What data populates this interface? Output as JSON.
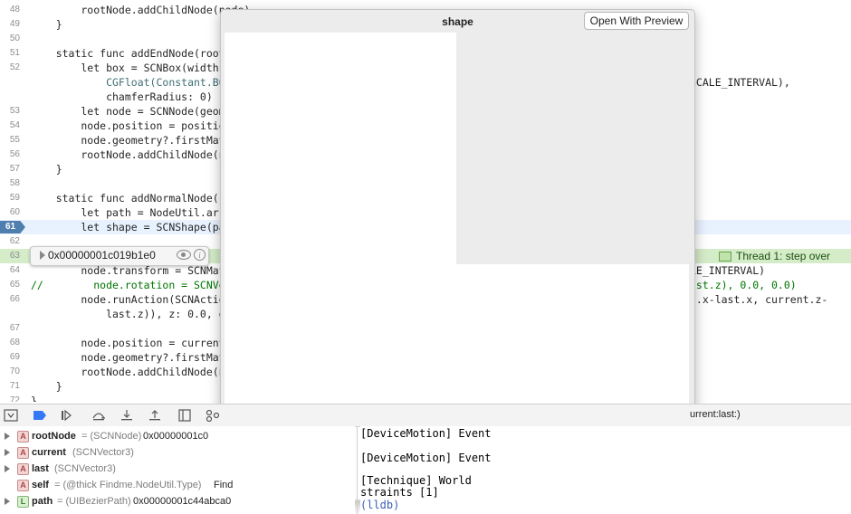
{
  "editor": {
    "lines": [
      {
        "num": "48",
        "text": "        rootNode.addChildNode(node)"
      },
      {
        "num": "49",
        "text": "    }"
      },
      {
        "num": "50",
        "text": ""
      },
      {
        "num": "51",
        "text": "    static func addEndNode(root"
      },
      {
        "num": "52",
        "text": "        let box = SCNBox(width:"
      },
      {
        "num": "",
        "text": "            CGFloat(Constant.BO"
      },
      {
        "num": "",
        "text": "            chamferRadius: 0)"
      },
      {
        "num": "53",
        "text": "        let node = SCNNode(geom"
      },
      {
        "num": "54",
        "text": "        node.position = positio"
      },
      {
        "num": "55",
        "text": "        node.geometry?.firstMat"
      },
      {
        "num": "56",
        "text": "        rootNode.addChildNode(n"
      },
      {
        "num": "57",
        "text": "    }"
      },
      {
        "num": "58",
        "text": ""
      },
      {
        "num": "59",
        "text": "    static func addNormalNode(r"
      },
      {
        "num": "60",
        "text": "        let path = NodeUtil.arr"
      },
      {
        "num": "61",
        "text": "        let shape = SCNShape(pa"
      },
      {
        "num": "62",
        "text": ""
      },
      {
        "num": "63",
        "text": ""
      },
      {
        "num": "64",
        "text": "        node.transform = SCNMat"
      },
      {
        "num": "65",
        "text": "//        node.rotation = SCNVe"
      },
      {
        "num": "66",
        "text": "        node.runAction(SCNActio"
      },
      {
        "num": "",
        "text": "            last.z)), z: 0.0, d"
      },
      {
        "num": "67",
        "text": ""
      },
      {
        "num": "68",
        "text": "        node.position = current"
      },
      {
        "num": "69",
        "text": "        node.geometry?.firstMat"
      },
      {
        "num": "70",
        "text": "        rootNode.addChildNode(n"
      },
      {
        "num": "71",
        "text": "    }"
      },
      {
        "num": "72",
        "text": "}"
      }
    ],
    "right_fragments": {
      "l52": "SCALE_INTERVAL),",
      "l64": "LE_INTERVAL)",
      "l65": "ast.z), 0.0, 0.0)",
      "l66": "t.x-last.x, current.z-"
    },
    "current_line_marker": "61",
    "thread_badge": "Thread 1: step over"
  },
  "datatip": {
    "value": "0x00000001c019b1e0",
    "info_glyph": "i"
  },
  "quicklook": {
    "title": "shape",
    "open_button": "Open With Preview"
  },
  "debug_bar": {
    "stack_label": "urrent:last:)"
  },
  "variables": [
    {
      "badge": "A",
      "name": "rootNode",
      "type": "= (SCNNode)",
      "value": "0x00000001c0"
    },
    {
      "badge": "A",
      "name": "current",
      "type": "(SCNVector3)",
      "value": ""
    },
    {
      "badge": "A",
      "name": "last",
      "type": "(SCNVector3)",
      "value": ""
    },
    {
      "badge": "A",
      "name": "self",
      "type": "= (@thick Findme.NodeUtil.Type)",
      "value": "Find"
    },
    {
      "badge": "L",
      "name": "path",
      "type": "= (UIBezierPath)",
      "value": "0x00000001c44abca0"
    }
  ],
  "console": {
    "lines": [
      "DeviceMotion] Event",
      "DeviceMotion] Event",
      "Technique] World",
      "straints [1]"
    ],
    "prompt": "(lldb)"
  },
  "colors": {
    "current_line": "#e8f2fe",
    "thread_line": "#d5ecc9",
    "pc_marker": "#4f7fae",
    "keyword": "#aa0d91"
  }
}
